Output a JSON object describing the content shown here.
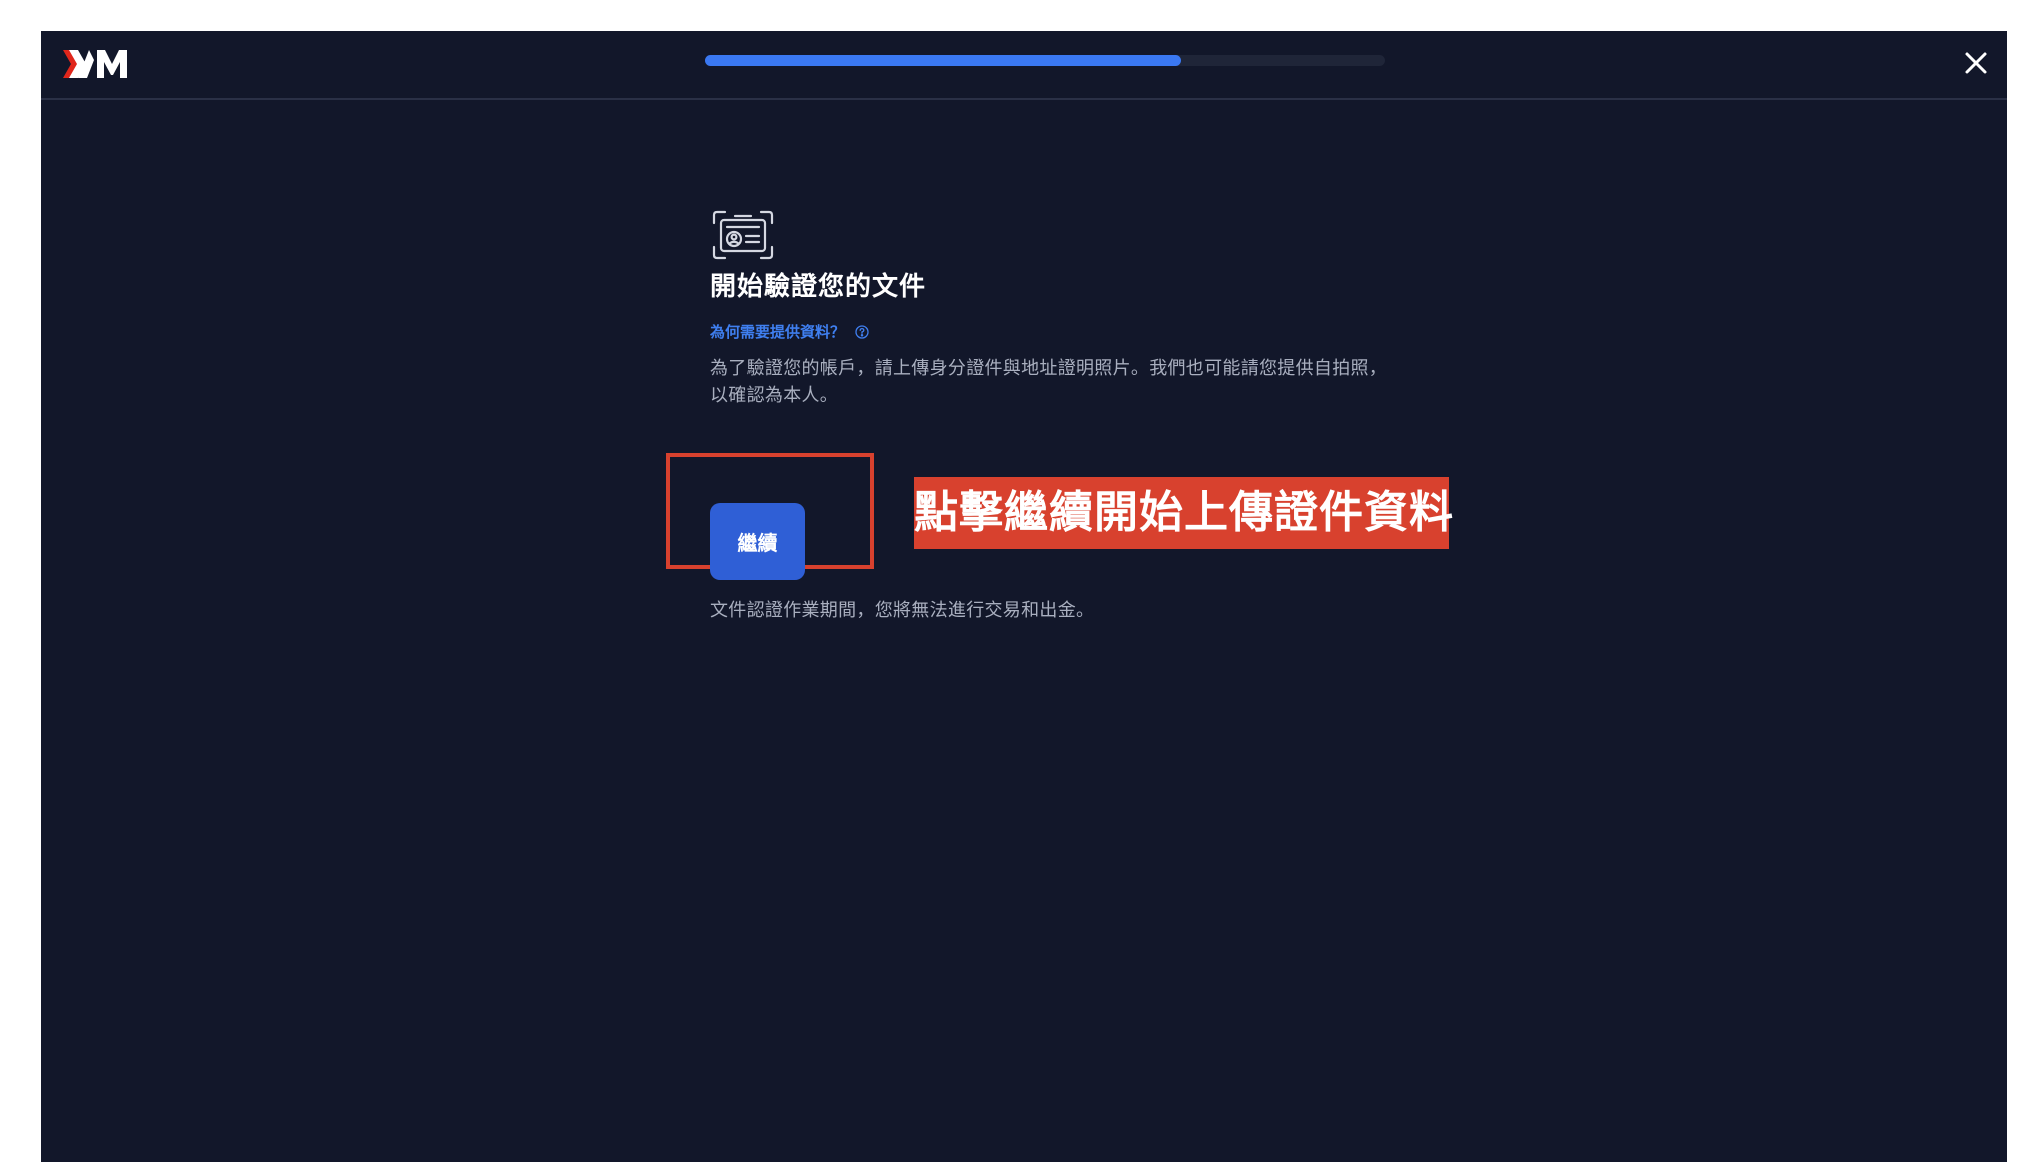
{
  "app": {
    "logo_text": "XM",
    "progress_percent": 70
  },
  "main": {
    "icon": "id-card-icon",
    "title": "開始驗證您的文件",
    "why_link": "為何需要提供資料？",
    "description": "為了驗證您的帳戶，請上傳身分證件與地址證明照片。我們也可能請您提供自拍照，以確認為本人。",
    "continue_label": "繼續",
    "note": "文件認證作業期間，您將無法進行交易和出金。"
  },
  "annotation": {
    "label": "點擊繼續開始上傳證件資料",
    "color": "#d8412e"
  },
  "colors": {
    "background": "#12172a",
    "accent": "#3a78f2",
    "button": "#2f5fd6"
  }
}
